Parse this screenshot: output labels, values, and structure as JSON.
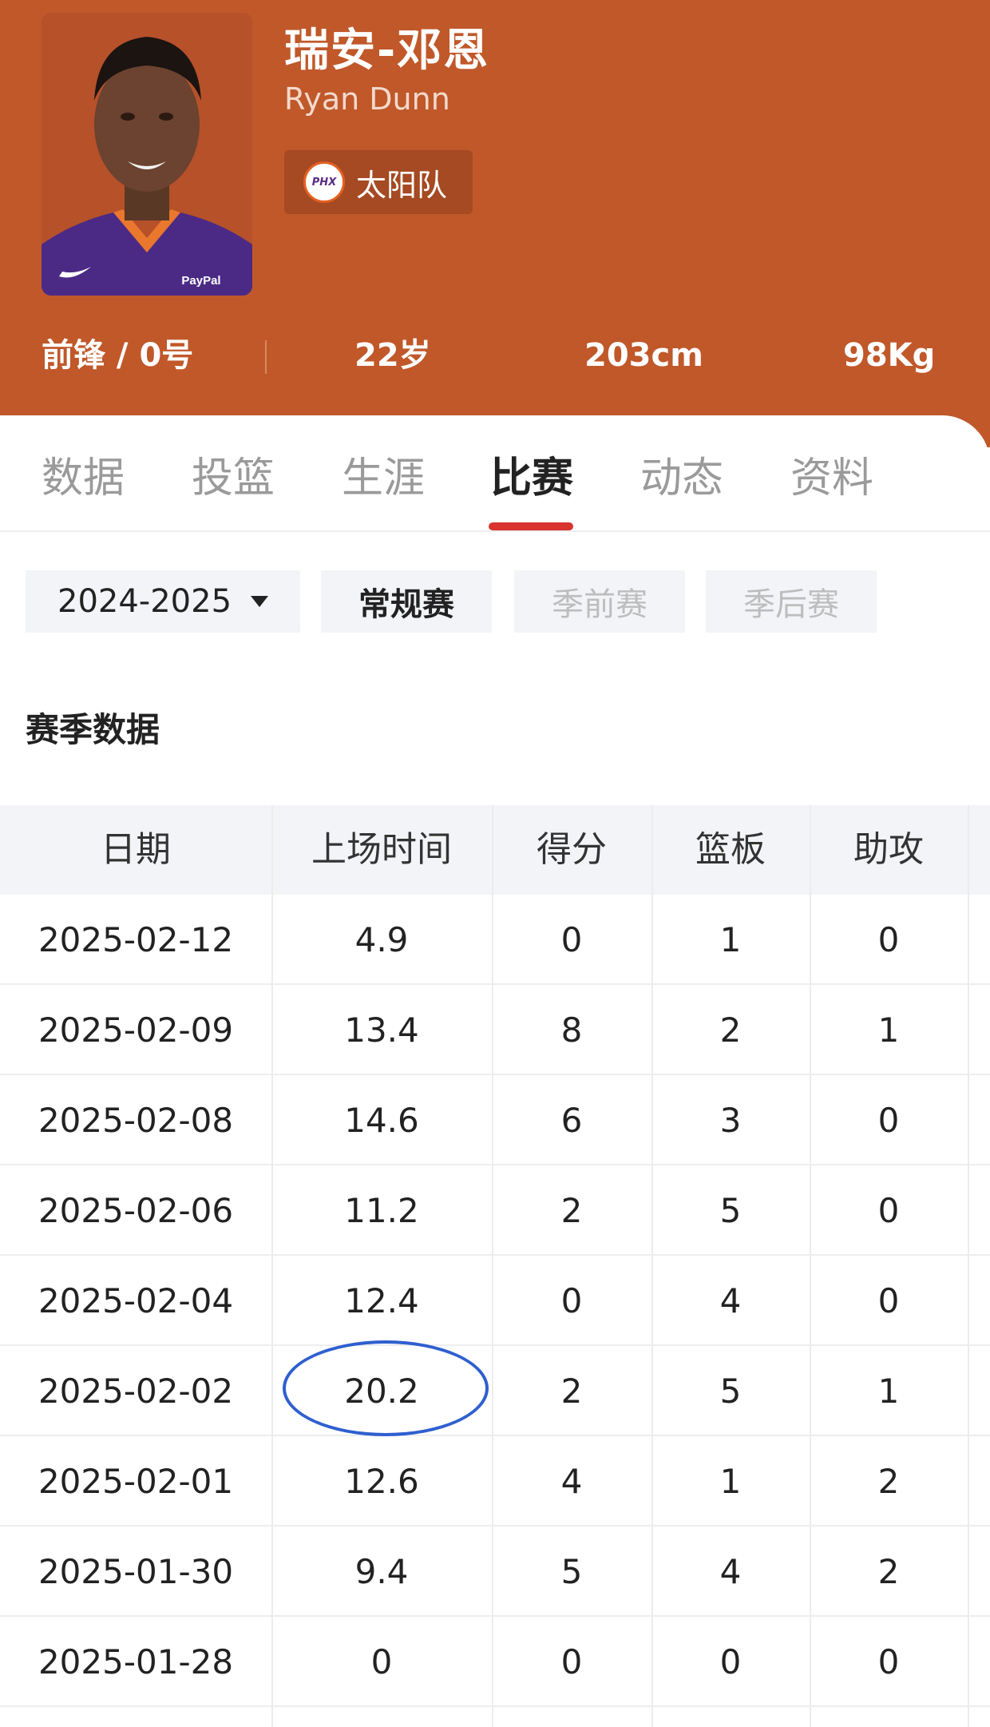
{
  "player": {
    "name_cn": "瑞安-邓恩",
    "name_en": "Ryan Dunn",
    "team": "太阳队",
    "team_logo_text": "PHX",
    "position_number": "前锋 / 0号",
    "age": "22岁",
    "height": "203cm",
    "weight": "98Kg",
    "jersey_text": "PayPal"
  },
  "tabs": [
    "数据",
    "投篮",
    "生涯",
    "比赛",
    "动态",
    "资料"
  ],
  "active_tab": "比赛",
  "filters": {
    "season": "2024-2025",
    "types": [
      "常规赛",
      "季前赛",
      "季后赛"
    ],
    "active_type": "常规赛"
  },
  "section_title": "赛季数据",
  "table": {
    "headers": [
      "日期",
      "上场时间",
      "得分",
      "篮板",
      "助攻"
    ],
    "rows": [
      [
        "2025-02-12",
        "4.9",
        "0",
        "1",
        "0"
      ],
      [
        "2025-02-09",
        "13.4",
        "8",
        "2",
        "1"
      ],
      [
        "2025-02-08",
        "14.6",
        "6",
        "3",
        "0"
      ],
      [
        "2025-02-06",
        "11.2",
        "2",
        "5",
        "0"
      ],
      [
        "2025-02-04",
        "12.4",
        "0",
        "4",
        "0"
      ],
      [
        "2025-02-02",
        "20.2",
        "2",
        "5",
        "1"
      ],
      [
        "2025-02-01",
        "12.6",
        "4",
        "1",
        "2"
      ],
      [
        "2025-01-30",
        "9.4",
        "5",
        "4",
        "2"
      ],
      [
        "2025-01-28",
        "0",
        "0",
        "0",
        "0"
      ]
    ],
    "highlighted_cell": "20.2"
  },
  "colors": {
    "header_bg": "#c0582a",
    "active_underline": "#d8332f",
    "highlight_ring": "#2f5fcf"
  }
}
